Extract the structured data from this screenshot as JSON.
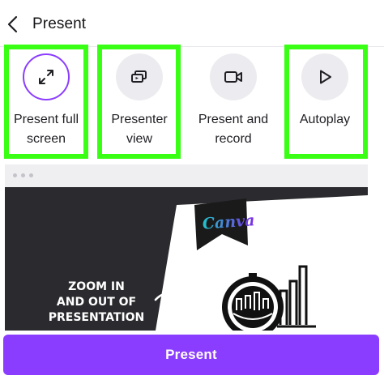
{
  "header": {
    "title": "Present"
  },
  "options": [
    {
      "label_line1": "Present full",
      "label_line2": "screen",
      "icon": "expand-arrows-icon"
    },
    {
      "label_line1": "Presenter",
      "label_line2": "view",
      "icon": "presenter-screens-icon"
    },
    {
      "label_line1": "Present and",
      "label_line2": "record",
      "icon": "video-camera-icon"
    },
    {
      "label_line1": "Autoplay",
      "label_line2": "",
      "icon": "play-icon"
    }
  ],
  "preview": {
    "brand": "Canva",
    "caption_lines": [
      "ZOOM IN",
      "AND OUT OF",
      "PRESENTATION"
    ]
  },
  "footer": {
    "present_label": "Present"
  },
  "colors": {
    "accent": "#8b3dff",
    "highlight": "#39ff14",
    "preview_bg": "#2b2b2f"
  }
}
